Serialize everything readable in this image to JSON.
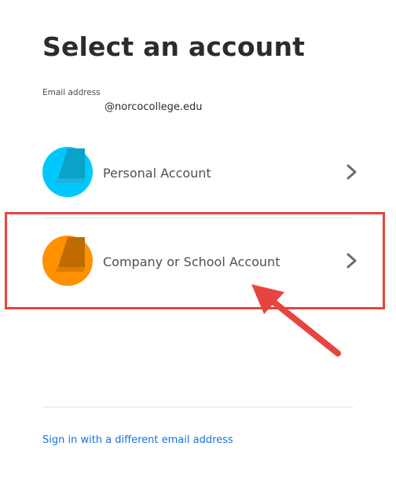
{
  "header": {
    "title": "Select an account"
  },
  "email": {
    "label": "Email address",
    "value": "@norcocollege.edu"
  },
  "accounts": [
    {
      "label": "Personal Account",
      "icon": "personal-account-avatar-icon",
      "color": "#00c8ff",
      "accent": "#0ba2c7"
    },
    {
      "label": "Company or School Account",
      "icon": "company-account-avatar-icon",
      "color": "#ff9000",
      "accent": "#c06b00"
    }
  ],
  "footer": {
    "alt_signin_label": "Sign in with a different email address"
  },
  "colors": {
    "link": "#1473e6",
    "highlight": "#e8443f",
    "text": "#2c2c2c"
  }
}
